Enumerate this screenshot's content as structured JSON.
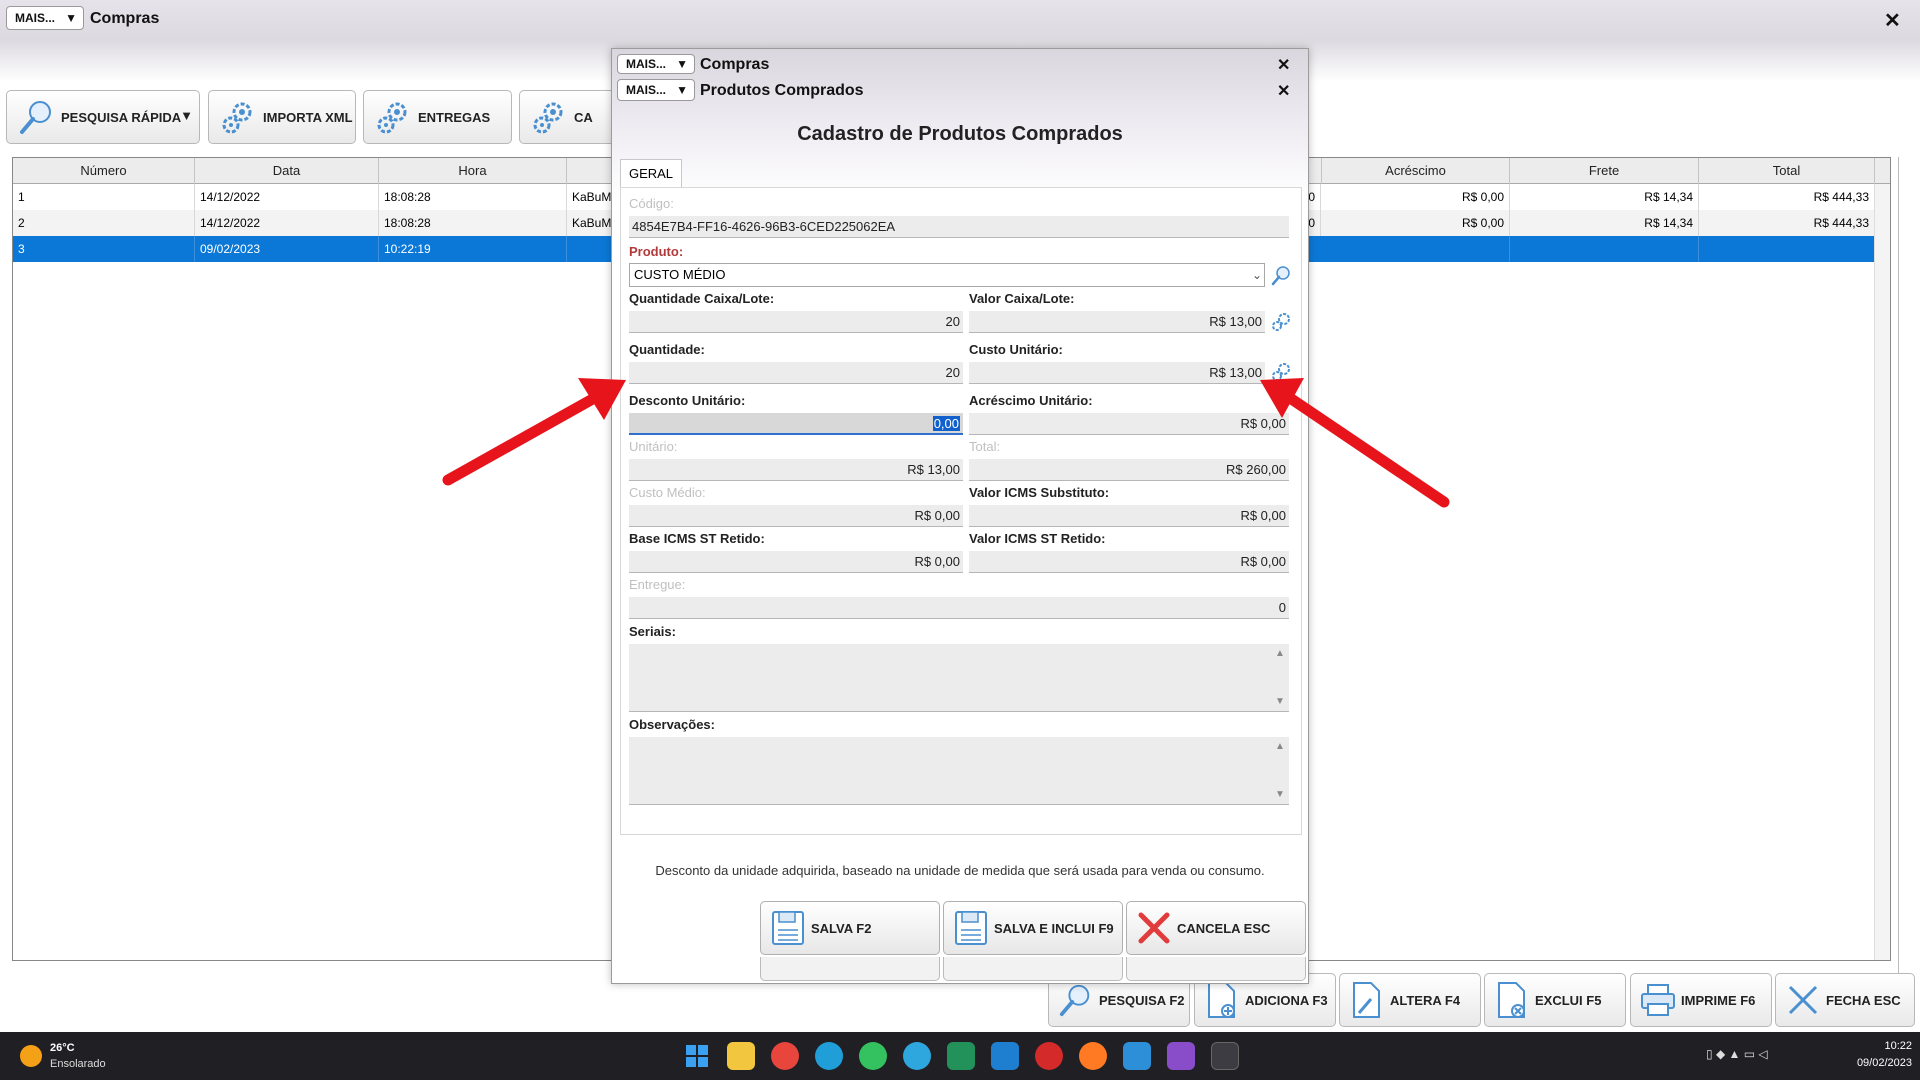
{
  "main_window": {
    "mais_label": "MAIS...",
    "title": "Compras",
    "close_glyph": "✕",
    "toolbar": {
      "pesquisa_rapida": "PESQUISA RÁPIDA",
      "importa_xml": "IMPORTA XML",
      "entregas": "ENTREGAS",
      "partial": "CA"
    },
    "grid": {
      "columns_left": [
        "Número",
        "Data",
        "Hora"
      ],
      "columns_right": [
        "Acréscimo",
        "Frete",
        "Total"
      ],
      "rows": [
        {
          "numero": "1",
          "data": "14/12/2022",
          "hora": "18:08:28",
          "partial": "KaBuM",
          "partial2": "0",
          "acrescimo": "R$ 0,00",
          "frete": "R$ 14,34",
          "total": "R$ 444,33"
        },
        {
          "numero": "2",
          "data": "14/12/2022",
          "hora": "18:08:28",
          "partial": "KaBuM",
          "partial2": "0",
          "acrescimo": "R$ 0,00",
          "frete": "R$ 14,34",
          "total": "R$ 444,33"
        },
        {
          "numero": "3",
          "data": "09/02/2023",
          "hora": "10:22:19",
          "partial": "",
          "partial2": "",
          "acrescimo": "",
          "frete": "",
          "total": ""
        }
      ],
      "selected_row": 3
    },
    "bottom_buttons": {
      "pesquisa": "PESQUISA F2",
      "adiciona": "ADICIONA F3",
      "altera": "ALTERA F4",
      "exclui": "EXCLUI F5",
      "imprime": "IMPRIME F6",
      "fecha": "FECHA ESC"
    }
  },
  "modal": {
    "mais_label": "MAIS...",
    "title_back": "Compras",
    "title_front": "Produtos Comprados",
    "heading": "Cadastro de Produtos Comprados",
    "tab": "GERAL",
    "fields": {
      "codigo_label": "Código:",
      "codigo_value": "4854E7B4-FF16-4626-96B3-6CED225062EA",
      "produto_label": "Produto:",
      "produto_value": "CUSTO MÉDIO",
      "qtd_caixa_label": "Quantidade Caixa/Lote:",
      "qtd_caixa_value": "20",
      "valor_caixa_label": "Valor Caixa/Lote:",
      "valor_caixa_value": "R$ 13,00",
      "quantidade_label": "Quantidade:",
      "quantidade_value": "20",
      "custo_unitario_label": "Custo Unitário:",
      "custo_unitario_value": "R$ 13,00",
      "desconto_label": "Desconto Unitário:",
      "desconto_value": "0,00",
      "acrescimo_label": "Acréscimo Unitário:",
      "acrescimo_value": "R$ 0,00",
      "unitario_label": "Unitário:",
      "unitario_value": "R$ 13,00",
      "total_label": "Total:",
      "total_value": "R$ 260,00",
      "custo_medio_label": "Custo Médio:",
      "custo_medio_value": "R$ 0,00",
      "icms_subst_label": "Valor ICMS Substituto:",
      "icms_subst_value": "R$ 0,00",
      "base_icms_label": "Base ICMS ST Retido:",
      "base_icms_value": "R$ 0,00",
      "valor_icms_st_label": "Valor ICMS ST Retido:",
      "valor_icms_st_value": "R$ 0,00",
      "entregue_label": "Entregue:",
      "entregue_value": "0",
      "seriais_label": "Seriais:",
      "observacoes_label": "Observações:"
    },
    "hint": "Desconto da unidade adquirida, baseado na unidade de medida que será usada para venda ou consumo.",
    "buttons": {
      "salva": "SALVA F2",
      "salva_inclui": "SALVA E INCLUI F9",
      "cancela": "CANCELA ESC"
    }
  },
  "taskbar": {
    "temperature": "26°C",
    "weather": "Ensolarado",
    "time": "10:22",
    "date": "09/02/2023"
  },
  "colors": {
    "selection": "#0b78d7",
    "annotation_arrow": "#e8141c",
    "cancel_x": "#e23b3b"
  }
}
